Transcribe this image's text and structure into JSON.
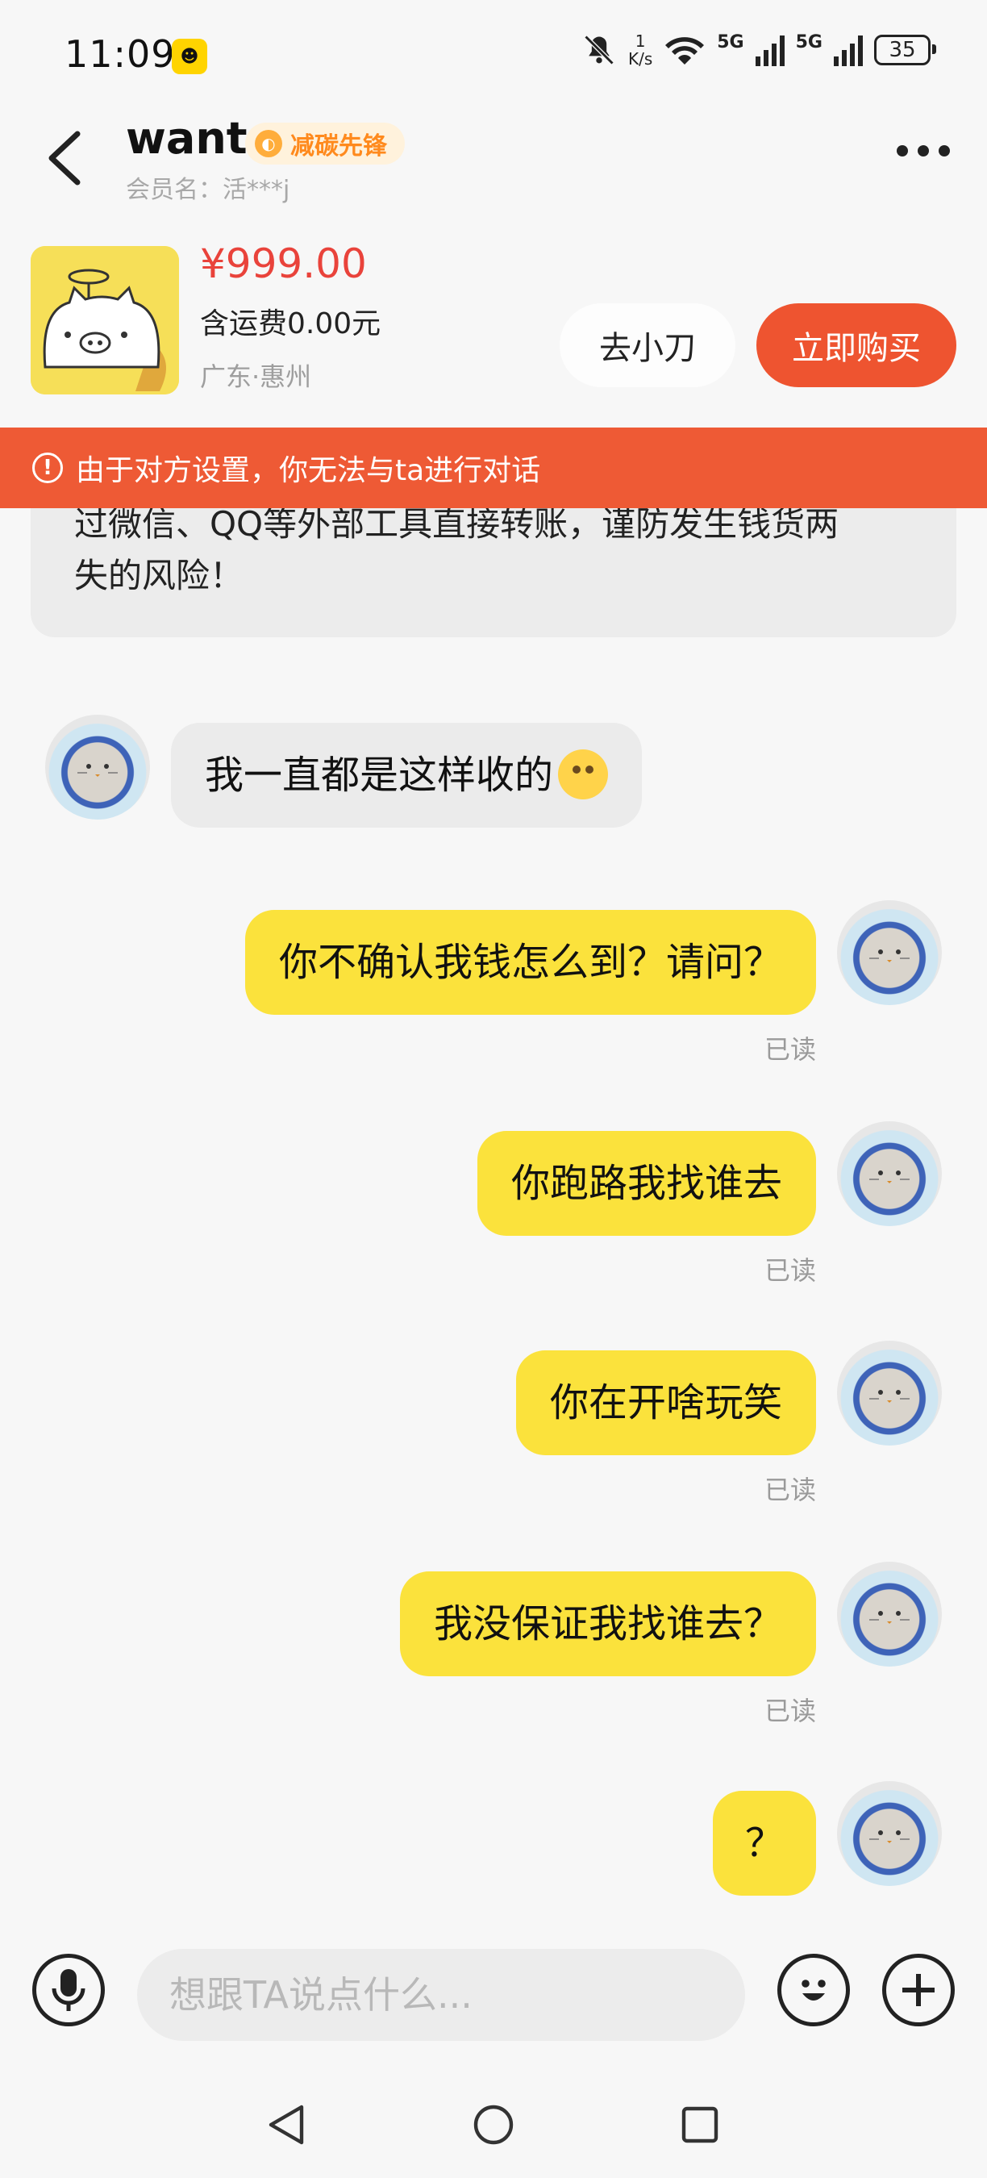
{
  "status_bar": {
    "time": "11:09",
    "speed_value": "1",
    "speed_unit": "K/s",
    "network_1": "5G",
    "network_2": "5G",
    "battery": "35"
  },
  "header": {
    "title": "want",
    "badge": "减碳先锋",
    "member_label": "会员名：活***j"
  },
  "product": {
    "price": "¥999.00",
    "shipping": "含运费0.00元",
    "location": "广东·惠州",
    "bargain_button": "去小刀",
    "buy_button": "立即购买"
  },
  "warning": {
    "icon": "!",
    "text": "由于对方设置，你无法与ta进行对话"
  },
  "notice": {
    "line1": "过微信、QQ等外部工具直接转账，谨防发生钱货两",
    "line2": "失的风险！"
  },
  "messages": [
    {
      "side": "in",
      "text": "我一直都是这样收的"
    },
    {
      "side": "out",
      "text": "你不确认我钱怎么到？请问？",
      "status": "已读"
    },
    {
      "side": "out",
      "text": "你跑路我找谁去",
      "status": "已读"
    },
    {
      "side": "out",
      "text": "你在开啥玩笑",
      "status": "已读"
    },
    {
      "side": "out",
      "text": "我没保证我找谁去？",
      "status": "已读"
    },
    {
      "side": "out",
      "text": "？"
    }
  ],
  "input": {
    "placeholder": "想跟TA说点什么..."
  },
  "icons": [
    "back-icon",
    "more-icon",
    "mic-icon",
    "emoji-icon",
    "plus-icon",
    "nav-back-icon",
    "nav-home-icon",
    "nav-recents-icon",
    "notification-muted-icon",
    "wifi-icon",
    "signal-icon",
    "battery-icon"
  ],
  "colors": {
    "accent": "#ee5430",
    "price": "#e9433b",
    "bubble_out": "#fbe23c",
    "bubble_in": "#ebebeb",
    "warning_bg": "#ee5a35"
  }
}
